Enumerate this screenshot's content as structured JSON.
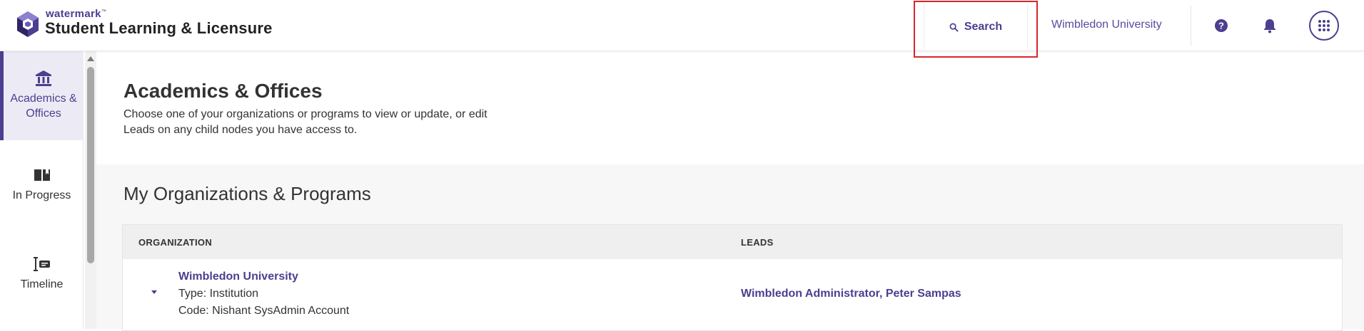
{
  "header": {
    "brand_small": "watermark",
    "brand_tm": "™",
    "app_title": "Student Learning & Licensure",
    "search_label": "Search",
    "org_name": "Wimbledon University",
    "colors": {
      "accent": "#4d3e8f",
      "highlight": "#d9262e"
    },
    "icons": [
      "search-icon",
      "help-icon",
      "bell-icon",
      "apps-grid-icon"
    ]
  },
  "sidebar": {
    "items": [
      {
        "label_line1": "Academics &",
        "label_line2": "Offices",
        "icon": "institution-icon",
        "active": true
      },
      {
        "label": "In Progress",
        "icon": "book-icon",
        "active": false
      },
      {
        "label": "Timeline",
        "icon": "timeline-icon",
        "active": false
      }
    ]
  },
  "main": {
    "page_title": "Academics & Offices",
    "page_desc_line1": "Choose one of your organizations or programs to view or update, or edit",
    "page_desc_line2": "Leads on any child nodes you have access to.",
    "section_title": "My Organizations & Programs",
    "table": {
      "columns": [
        "ORGANIZATION",
        "LEADS"
      ],
      "rows": [
        {
          "name": "Wimbledon University",
          "type": "Type: Institution",
          "code": "Code: Nishant SysAdmin Account",
          "leads": [
            "Wimbledon Administrator",
            "Peter Sampas"
          ],
          "lead_separator": ", "
        }
      ]
    }
  }
}
